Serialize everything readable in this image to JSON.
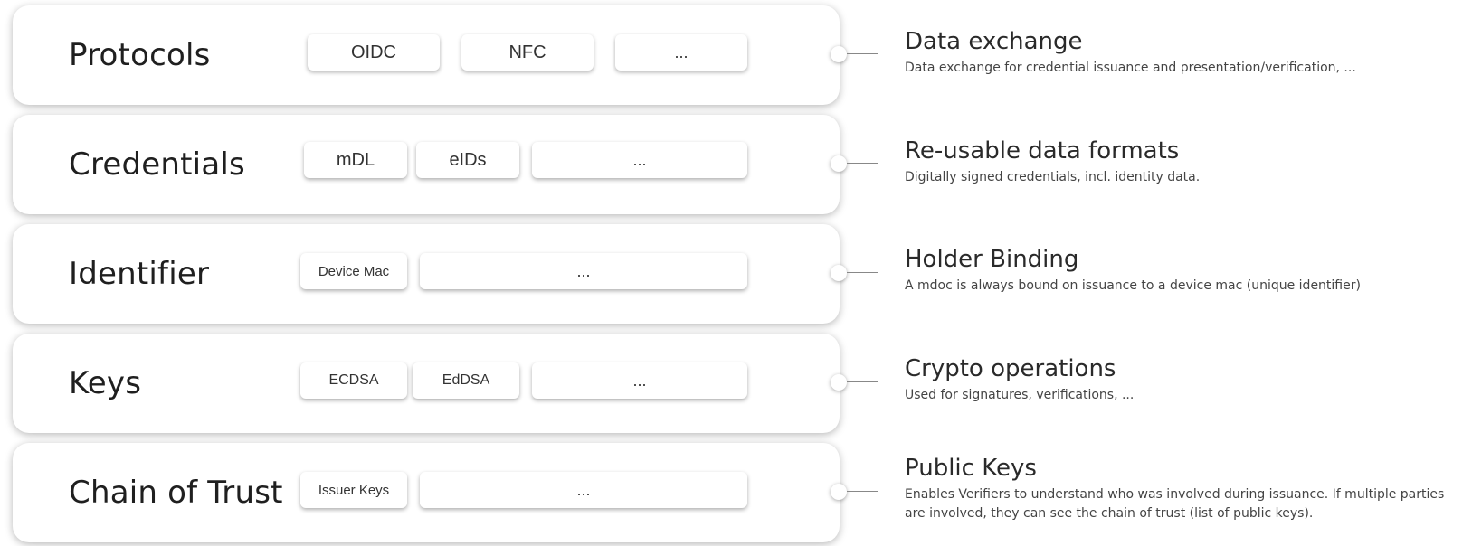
{
  "layers": [
    {
      "title": "Protocols",
      "chips": [
        "OIDC",
        "NFC",
        "..."
      ],
      "heading": "Data exchange",
      "description": "Data exchange for credential issuance and presentation/verification, ..."
    },
    {
      "title": "Credentials",
      "chips": [
        "mDL",
        "eIDs",
        "..."
      ],
      "heading": "Re-usable data formats",
      "description": "Digitally signed credentials, incl. identity data."
    },
    {
      "title": "Identifier",
      "chips": [
        "Device Mac",
        "..."
      ],
      "heading": "Holder Binding",
      "description": "A mdoc is always bound on issuance to a device mac (unique identifier)"
    },
    {
      "title": "Keys",
      "chips": [
        "ECDSA",
        "EdDSA",
        "..."
      ],
      "heading": "Crypto operations",
      "description": "Used for signatures, verifications, ..."
    },
    {
      "title": "Chain of Trust",
      "chips": [
        "Issuer Keys",
        "..."
      ],
      "heading": "Public Keys",
      "description": "Enables Verifiers to understand who was involved during issuance. If multiple parties are involved, they can see the chain of trust (list of public keys)."
    }
  ]
}
